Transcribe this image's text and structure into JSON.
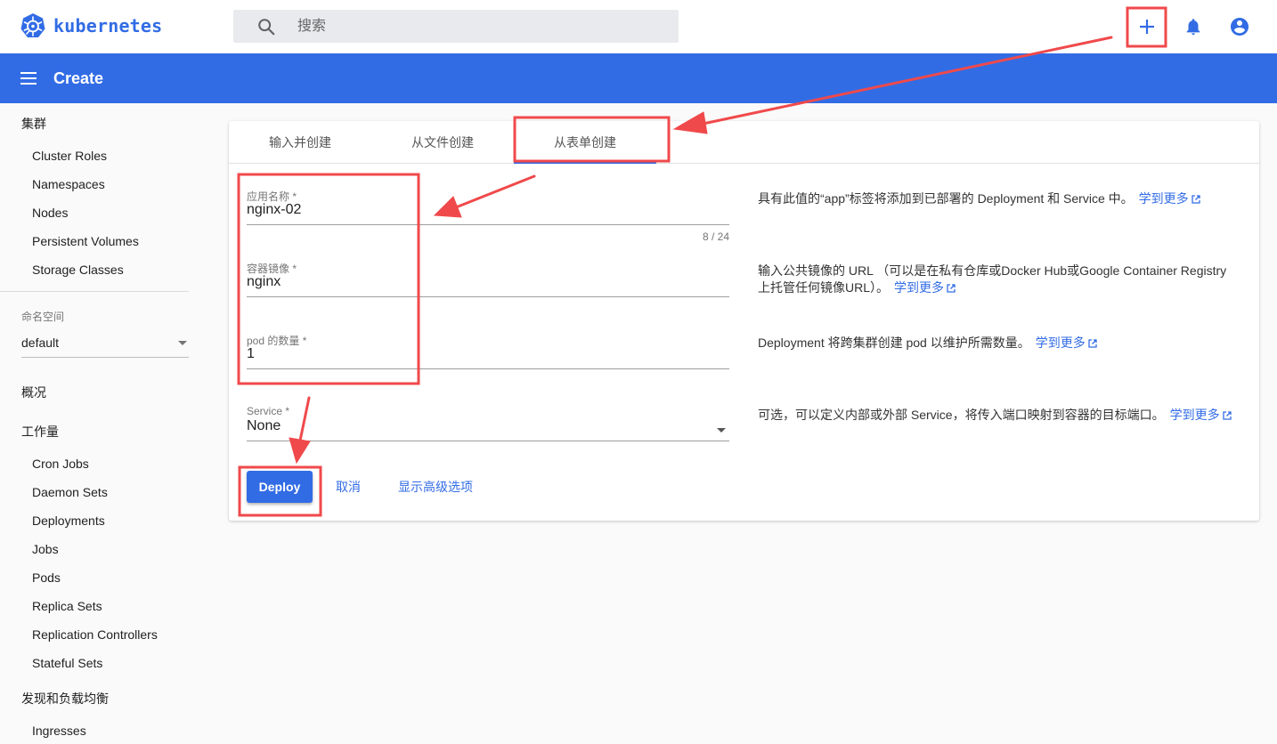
{
  "app": {
    "brand": "kubernetes"
  },
  "search": {
    "placeholder": "搜索"
  },
  "header": {
    "title": "Create"
  },
  "sidebar": {
    "sections": [
      {
        "label": "集群",
        "items": [
          "Cluster Roles",
          "Namespaces",
          "Nodes",
          "Persistent Volumes",
          "Storage Classes"
        ]
      },
      {
        "label": "概况",
        "items": []
      },
      {
        "label": "工作量",
        "items": [
          "Cron Jobs",
          "Daemon Sets",
          "Deployments",
          "Jobs",
          "Pods",
          "Replica Sets",
          "Replication Controllers",
          "Stateful Sets"
        ]
      },
      {
        "label": "发现和负载均衡",
        "items": [
          "Ingresses"
        ]
      }
    ],
    "namespace": {
      "label": "命名空间",
      "value": "default"
    }
  },
  "tabs": [
    {
      "label": "输入并创建",
      "active": false
    },
    {
      "label": "从文件创建",
      "active": false
    },
    {
      "label": "从表单创建",
      "active": true
    }
  ],
  "form": {
    "app_name": {
      "label": "应用名称 *",
      "value": "nginx-02",
      "counter": "8 / 24"
    },
    "image": {
      "label": "容器镜像 *",
      "value": "nginx"
    },
    "pods": {
      "label": "pod 的数量 *",
      "value": "1"
    },
    "service": {
      "label": "Service *",
      "value": "None"
    }
  },
  "help": {
    "app_name": "具有此值的“app”标签将添加到已部署的 Deployment 和 Service 中。",
    "image": "输入公共镜像的 URL （可以是在私有仓库或Docker Hub或Google Container Registry上托管任何镜像URL）。",
    "pods": "Deployment 将跨集群创建 pod 以维护所需数量。",
    "service": "可选，可以定义内部或外部 Service，将传入端口映射到容器的目标端口。",
    "learn_more": "学到更多"
  },
  "actions": {
    "deploy": "Deploy",
    "cancel": "取消",
    "advanced": "显示高级选项"
  },
  "colors": {
    "primary": "#326ce5",
    "annotation": "#f0494b"
  }
}
